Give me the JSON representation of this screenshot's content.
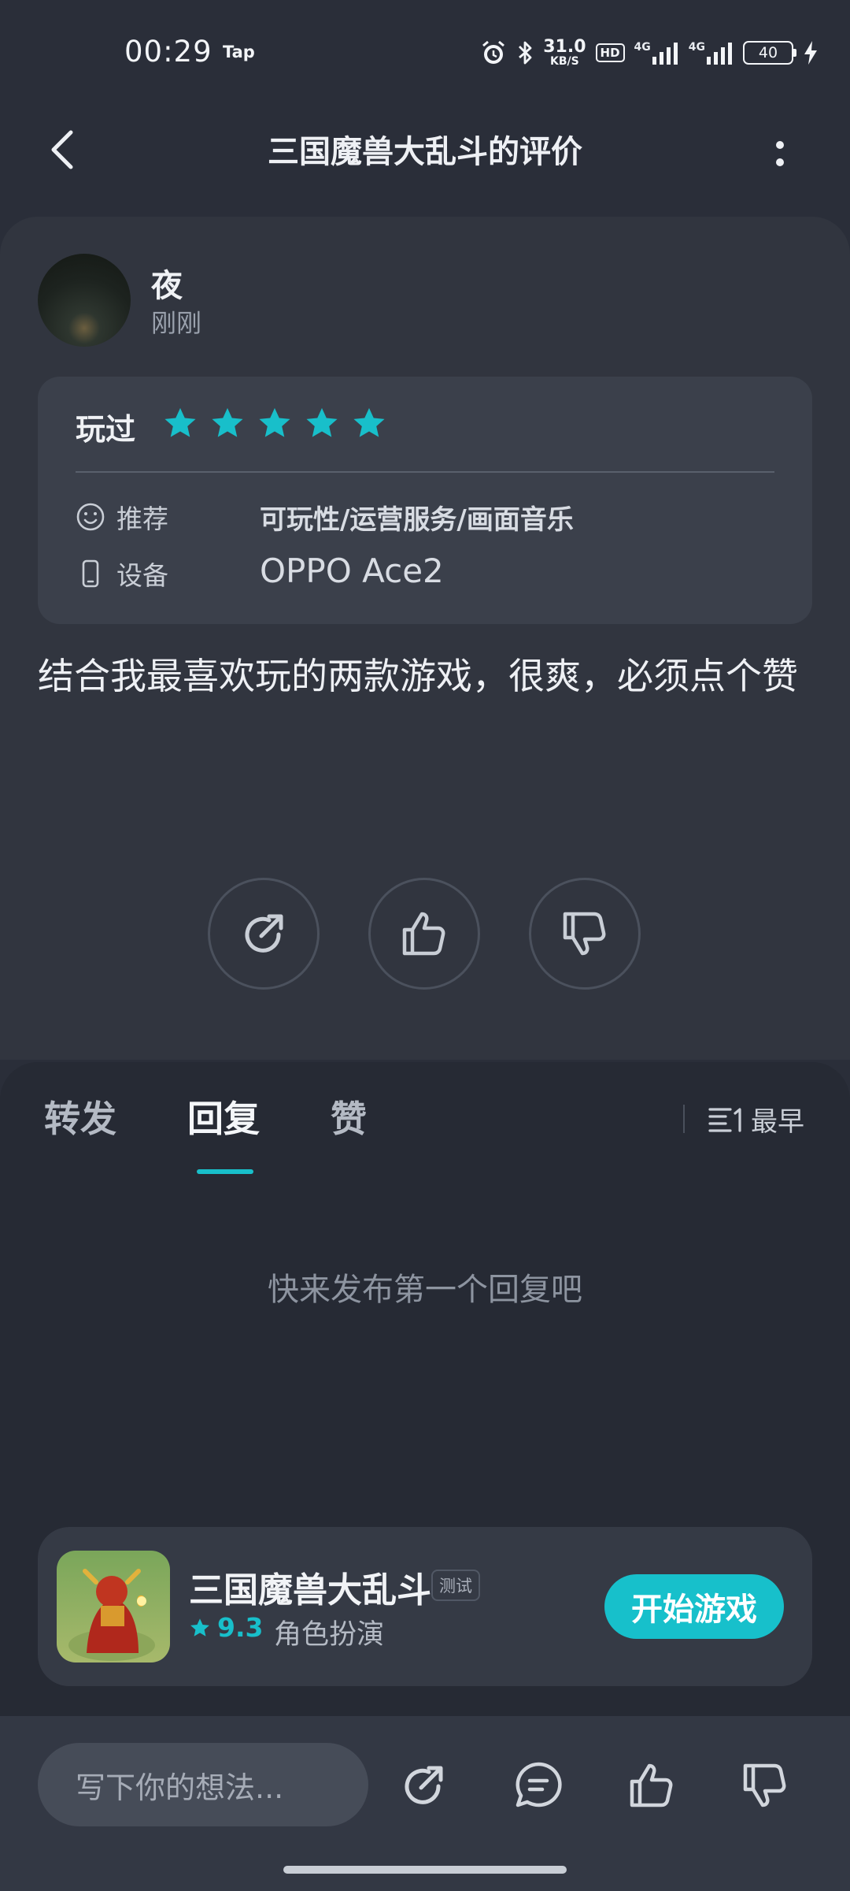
{
  "status_bar": {
    "time": "00:29",
    "app_indicator": "Tap",
    "net_speed_value": "31.0",
    "net_speed_unit": "KB/S",
    "hd_label": "HD",
    "signal1_label": "4G",
    "signal2_label": "4G",
    "battery_level": "40",
    "icons": [
      "alarm-icon",
      "bluetooth-icon",
      "signal-icon",
      "charging-icon"
    ]
  },
  "header": {
    "title": "三国魔兽大乱斗的评价"
  },
  "review": {
    "author": "夜",
    "time": "刚刚",
    "played_label": "玩过",
    "stars": 5,
    "recommend_label": "推荐",
    "recommend_value": "可玩性/运营服务/画面音乐",
    "device_label": "设备",
    "device_value": "OPPO Ace2",
    "text": "结合我最喜欢玩的两款游戏，很爽，必须点个赞"
  },
  "tabs": {
    "repost": "转发",
    "reply": "回复",
    "like": "赞",
    "active": "reply"
  },
  "sort": {
    "label": "最早"
  },
  "empty_state": "快来发布第一个回复吧",
  "game": {
    "name": "三国魔兽大乱斗",
    "badge": "测试",
    "rating": "9.3",
    "genre": "角色扮演",
    "start_label": "开始游戏"
  },
  "bottom_bar": {
    "placeholder": "写下你的想法..."
  },
  "colors": {
    "accent": "#18bfca",
    "background": "#2a2e39",
    "card": "#31353f"
  }
}
